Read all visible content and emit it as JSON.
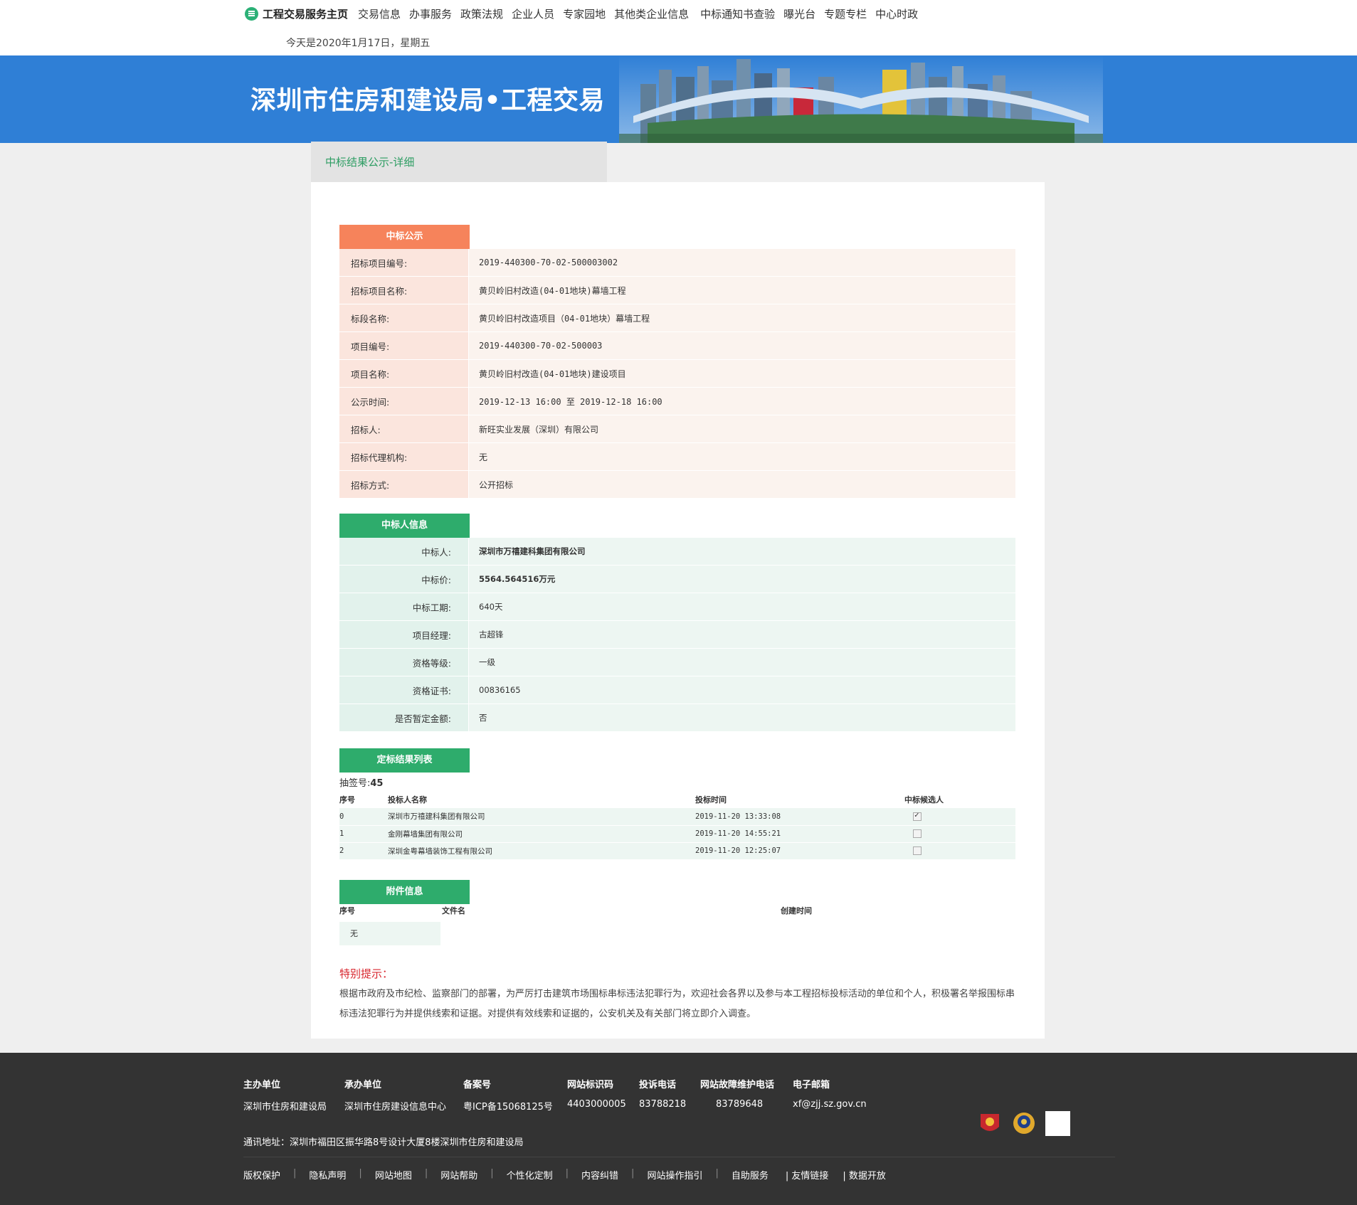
{
  "nav": {
    "home": "工程交易服务主页",
    "links": [
      "交易信息",
      "办事服务",
      "政策法规",
      "企业人员",
      "专家园地",
      "其他类企业信息",
      "中标通知书查验",
      "曝光台",
      "专题专栏",
      "中心时政"
    ],
    "date": "今天是2020年1月17日，星期五"
  },
  "banner": {
    "title": "深圳市住房和建设局•工程交易"
  },
  "breadcrumb": "中标结果公示-详细",
  "award_notice": {
    "tab": "中标公示",
    "rows": [
      {
        "label": "招标项目编号:",
        "value": "2019-440300-70-02-500003002"
      },
      {
        "label": "招标项目名称:",
        "value": "黄贝岭旧村改造(04-01地块)幕墙工程"
      },
      {
        "label": "标段名称:",
        "value": "黄贝岭旧村改造项目（04-01地块）幕墙工程"
      },
      {
        "label": "项目编号:",
        "value": "2019-440300-70-02-500003"
      },
      {
        "label": "项目名称:",
        "value": "黄贝岭旧村改造(04-01地块)建设项目"
      },
      {
        "label": "公示时间:",
        "value": "2019-12-13 16:00 至 2019-12-18 16:00"
      },
      {
        "label": "招标人:",
        "value": "新旺实业发展（深圳）有限公司"
      },
      {
        "label": "招标代理机构:",
        "value": "无"
      },
      {
        "label": "招标方式:",
        "value": "公开招标"
      }
    ]
  },
  "winner_info": {
    "tab": "中标人信息",
    "rows": [
      {
        "label": "中标人:",
        "value": "深圳市万禧建科集团有限公司"
      },
      {
        "label": "中标价:",
        "value": "5564.564516万元"
      },
      {
        "label": "中标工期:",
        "value": "640天"
      },
      {
        "label": "项目经理:",
        "value": "古超锋"
      },
      {
        "label": "资格等级:",
        "value": "一级"
      },
      {
        "label": "资格证书:",
        "value": "00836165"
      },
      {
        "label": "是否暂定金额:",
        "value": "否"
      }
    ]
  },
  "result_list": {
    "tab": "定标结果列表",
    "lot_label": "抽签号:",
    "lot_value": "45",
    "headers": [
      "序号",
      "投标人名称",
      "投标时间",
      "中标候选人"
    ],
    "rows": [
      {
        "index": "0",
        "name": "深圳市万禧建科集团有限公司",
        "time": "2019-11-20 13:33:08",
        "candidate": true
      },
      {
        "index": "1",
        "name": "金刚幕墙集团有限公司",
        "time": "2019-11-20 14:55:21",
        "candidate": false
      },
      {
        "index": "2",
        "name": "深圳金粤幕墙装饰工程有限公司",
        "time": "2019-11-20 12:25:07",
        "candidate": false
      }
    ]
  },
  "attachments": {
    "tab": "附件信息",
    "headers": [
      "序号",
      "文件名",
      "创建时间"
    ],
    "empty": "无"
  },
  "notice": {
    "title": "特别提示：",
    "text": "根据市政府及市纪检、监察部门的部署，为严厉打击建筑市场围标串标违法犯罪行为，欢迎社会各界以及参与本工程招标投标活动的单位和个人，积极署名举报围标串标违法犯罪行为并提供线索和证据。对提供有效线索和证据的，公安机关及有关部门将立即介入调查。"
  },
  "footer": {
    "cols": [
      {
        "head": "主办单位",
        "value": "深圳市住房和建设局"
      },
      {
        "head": "承办单位",
        "value": "深圳市住房建设信息中心"
      },
      {
        "head": "备案号",
        "value": "粤ICP备15068125号"
      },
      {
        "head": "网站标识码",
        "value": "4403000005"
      },
      {
        "head": "投诉电话",
        "value": "83788218"
      },
      {
        "head": "网站故障维护电话",
        "value": "83789648"
      },
      {
        "head": "电子邮箱",
        "value": "xf@zjj.sz.gov.cn"
      }
    ],
    "address": "通讯地址：深圳市福田区振华路8号设计大厦8楼深圳市住房和建设局",
    "links": [
      "版权保护",
      "隐私声明",
      "网站地图",
      "网站帮助",
      "个性化定制",
      "内容纠错",
      "网站操作指引",
      "自助服务",
      "| 友情链接",
      "| 数据开放"
    ]
  },
  "colors": {
    "banner": "#2f7fd6",
    "orange_tab": "#f6835b",
    "green_tab": "#2eac6c",
    "notice_red": "#d8262e",
    "footer": "#333333"
  }
}
